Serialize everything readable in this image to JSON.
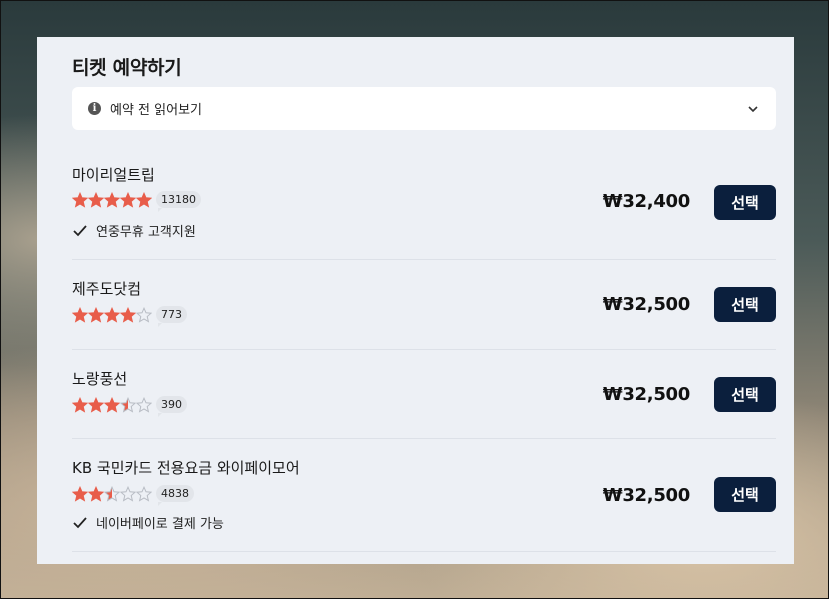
{
  "panel": {
    "title": "티켓 예약하기",
    "notice": {
      "icon": "info-icon",
      "label": "예약 전 읽어보기",
      "expand_icon": "chevron-down-icon"
    }
  },
  "colors": {
    "star_filled": "#e85d4a",
    "star_empty": "#b8bcc4",
    "button_bg": "#0b1f3d"
  },
  "offers": [
    {
      "name": "마이리얼트립",
      "rating": 5,
      "reviews": "13180",
      "feature": "연중무휴 고객지원",
      "price": "₩32,400",
      "select_label": "선택"
    },
    {
      "name": "제주도닷컴",
      "rating": 4,
      "reviews": "773",
      "feature": "",
      "price": "₩32,500",
      "select_label": "선택"
    },
    {
      "name": "노랑풍선",
      "rating": 3.5,
      "reviews": "390",
      "feature": "",
      "price": "₩32,500",
      "select_label": "선택"
    },
    {
      "name": "KB 국민카드 전용요금 와이페이모어",
      "rating": 2.5,
      "reviews": "4838",
      "feature": "네이버페이로 결제 가능",
      "price": "₩32,500",
      "select_label": "선택"
    }
  ]
}
